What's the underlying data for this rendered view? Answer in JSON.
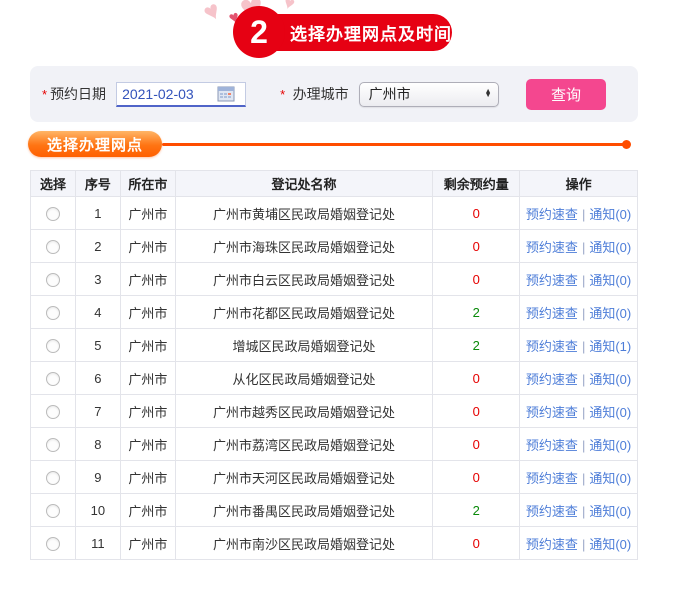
{
  "step": {
    "number": "2",
    "title": "选择办理网点及时间"
  },
  "form": {
    "required_mark": "*",
    "date_label": "预约日期",
    "date_value": "2021-02-03",
    "city_label": "办理城市",
    "city_value": "广州市",
    "query_button_label": "查询"
  },
  "section": {
    "title": "选择办理网点"
  },
  "table": {
    "headers": [
      "选择",
      "序号",
      "所在市",
      "登记处名称",
      "剩余预约量",
      "操作"
    ],
    "quick_check_label": "预约速查",
    "link_separator": "|",
    "rows": [
      {
        "seq": "1",
        "city": "广州市",
        "name": "广州市黄埔区民政局婚姻登记处",
        "remaining": "0",
        "notice_label": "通知(0)"
      },
      {
        "seq": "2",
        "city": "广州市",
        "name": "广州市海珠区民政局婚姻登记处",
        "remaining": "0",
        "notice_label": "通知(0)"
      },
      {
        "seq": "3",
        "city": "广州市",
        "name": "广州市白云区民政局婚姻登记处",
        "remaining": "0",
        "notice_label": "通知(0)"
      },
      {
        "seq": "4",
        "city": "广州市",
        "name": "广州市花都区民政局婚姻登记处",
        "remaining": "2",
        "notice_label": "通知(0)"
      },
      {
        "seq": "5",
        "city": "广州市",
        "name": "增城区民政局婚姻登记处",
        "remaining": "2",
        "notice_label": "通知(1)"
      },
      {
        "seq": "6",
        "city": "广州市",
        "name": "从化区民政局婚姻登记处",
        "remaining": "0",
        "notice_label": "通知(0)"
      },
      {
        "seq": "7",
        "city": "广州市",
        "name": "广州市越秀区民政局婚姻登记处",
        "remaining": "0",
        "notice_label": "通知(0)"
      },
      {
        "seq": "8",
        "city": "广州市",
        "name": "广州市荔湾区民政局婚姻登记处",
        "remaining": "0",
        "notice_label": "通知(0)"
      },
      {
        "seq": "9",
        "city": "广州市",
        "name": "广州市天河区民政局婚姻登记处",
        "remaining": "0",
        "notice_label": "通知(0)"
      },
      {
        "seq": "10",
        "city": "广州市",
        "name": "广州市番禺区民政局婚姻登记处",
        "remaining": "2",
        "notice_label": "通知(0)"
      },
      {
        "seq": "11",
        "city": "广州市",
        "name": "广州市南沙区民政局婚姻登记处",
        "remaining": "0",
        "notice_label": "通知(0)"
      }
    ]
  },
  "colors": {
    "step_red": "#e60113",
    "section_orange": "#ff5a00",
    "query_pink": "#f4478f",
    "link_blue": "#4d7dd8",
    "remaining_zero_red": "#e60000",
    "remaining_available_green": "#0a8a0a"
  }
}
